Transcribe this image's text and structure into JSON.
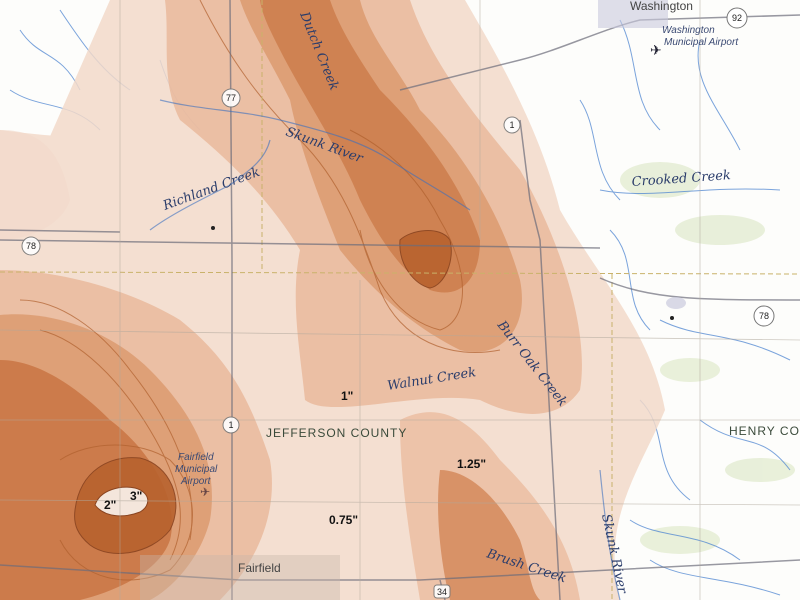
{
  "places": {
    "washington": "Washington",
    "washington_airport_line1": "Washington",
    "washington_airport_line2": "Municipal Airport",
    "fairfield": "Fairfield",
    "fairfield_airport_line1": "Fairfield",
    "fairfield_airport_line2": "Municipal",
    "fairfield_airport_line3": "Airport"
  },
  "counties": {
    "jefferson": "JEFFERSON COUNTY",
    "henry": "HENRY COU"
  },
  "waterways": {
    "dutch_creek": "Dutch Creek",
    "skunk_river": "Skunk River",
    "richland_creek": "Richland Creek",
    "crooked_creek": "Crooked Creek",
    "walnut_creek": "Walnut Creek",
    "burr_oak_creek": "Burr Oak Creek",
    "brush_creek": "Brush Creek",
    "skunk_river_south": "Skunk River"
  },
  "routes": {
    "r92": "92",
    "r77": "77",
    "r1_north": "1",
    "r78_west": "78",
    "r78_east": "78",
    "r1_south": "1",
    "r34": "34"
  },
  "rain_labels": {
    "one": "1\"",
    "one_quarter": "1.25\"",
    "three_quarter": "0.75\"",
    "two": "2\"",
    "three": "3\""
  },
  "colors": {
    "rain_light": "#f2d9c9",
    "rain_mid": "#d9976a",
    "rain_dark": "#b8622e",
    "rain_outline": "#b0602e",
    "water": "#3b6fbf",
    "road": "#6c6c7a",
    "county_line": "#c9b26a"
  }
}
